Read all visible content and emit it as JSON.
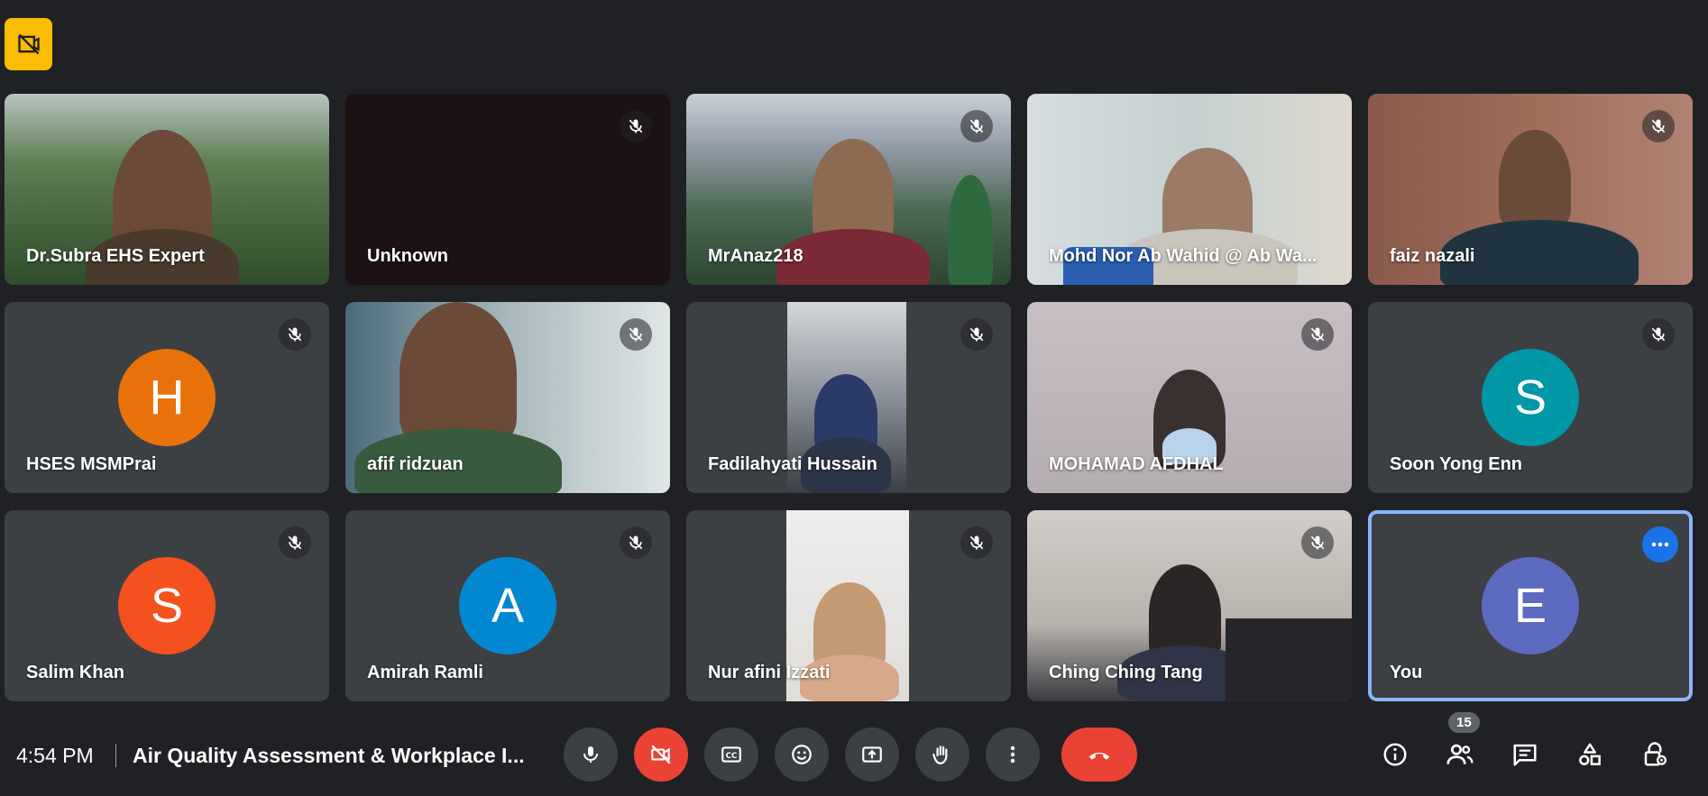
{
  "participants": [
    {
      "name": "Dr.Subra EHS Expert"
    },
    {
      "name": "Unknown"
    },
    {
      "name": "MrAnaz218"
    },
    {
      "name": "Mohd Nor Ab Wahid @ Ab Wa..."
    },
    {
      "name": "faiz nazali"
    },
    {
      "name": "HSES MSMPrai",
      "initial": "H"
    },
    {
      "name": "afif ridzuan"
    },
    {
      "name": "Fadilahyati Hussain"
    },
    {
      "name": "MOHAMAD AFDHAL"
    },
    {
      "name": "Soon Yong Enn",
      "initial": "S"
    },
    {
      "name": "Salim Khan",
      "initial": "S"
    },
    {
      "name": "Amirah Ramli",
      "initial": "A"
    },
    {
      "name": "Nur afini Izzati"
    },
    {
      "name": "Ching Ching Tang"
    },
    {
      "name": "You",
      "initial": "E"
    }
  ],
  "colors": {
    "avatar_orange": "#e8710a",
    "avatar_teal": "#0097a7",
    "avatar_red": "#f4511e",
    "avatar_blue": "#0288d1",
    "avatar_purple": "#5c6bc0",
    "accent_red": "#ea4335",
    "badge_yellow": "#fbbc04"
  },
  "bottombar": {
    "time": "4:54 PM",
    "meeting_title": "Air Quality Assessment & Workplace I...",
    "participant_count": "15"
  },
  "icons": {
    "top_badge": "no-recording-icon",
    "controls": [
      "microphone-icon",
      "camera-off-icon",
      "captions-icon",
      "emoji-icon",
      "present-icon",
      "raise-hand-icon",
      "more-vert-icon",
      "end-call-icon"
    ],
    "right": [
      "info-icon",
      "people-icon",
      "chat-icon",
      "activities-icon",
      "host-controls-icon"
    ]
  }
}
